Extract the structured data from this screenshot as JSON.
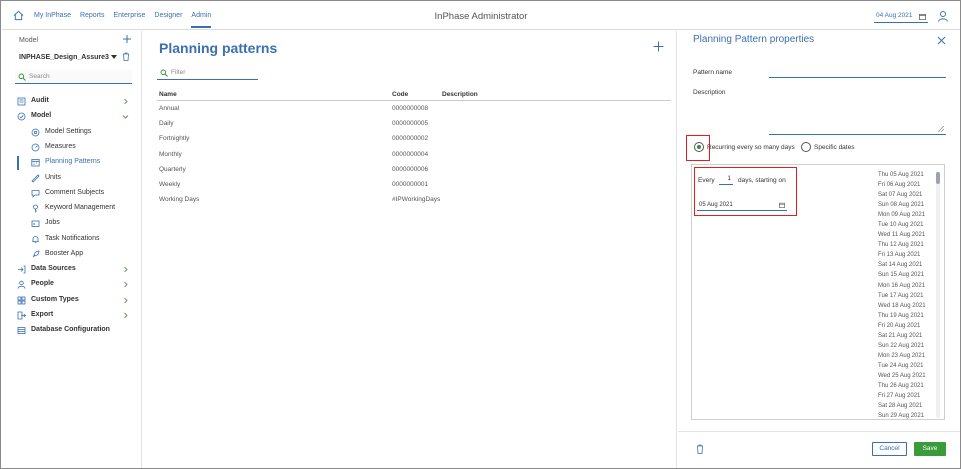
{
  "nav": {
    "links": [
      "My InPhase",
      "Reports",
      "Enterprise",
      "Designer",
      "Admin"
    ],
    "active": "Admin",
    "app_title": "InPhase Administrator",
    "date": "04 Aug 2021"
  },
  "sidebar": {
    "model_label": "Model",
    "model_name": "INPHASE_Design_Assure3",
    "search_placeholder": "Search",
    "items": [
      {
        "label": "Audit",
        "level": "top",
        "icon": "audit-icon",
        "chevron": "right"
      },
      {
        "label": "Model",
        "level": "top",
        "icon": "model-icon",
        "chevron": "down"
      },
      {
        "label": "Model Settings",
        "level": "sub",
        "icon": "settings-icon"
      },
      {
        "label": "Measures",
        "level": "sub",
        "icon": "gauge-icon"
      },
      {
        "label": "Planning Patterns",
        "level": "sub",
        "icon": "calendar-icon",
        "selected": true
      },
      {
        "label": "Units",
        "level": "sub",
        "icon": "ruler-icon"
      },
      {
        "label": "Comment Subjects",
        "level": "sub",
        "icon": "comment-icon"
      },
      {
        "label": "Keyword Management",
        "level": "sub",
        "icon": "key-icon"
      },
      {
        "label": "Jobs",
        "level": "sub",
        "icon": "jobs-icon"
      },
      {
        "label": "Task Notifications",
        "level": "sub",
        "icon": "bell-icon"
      },
      {
        "label": "Booster App",
        "level": "sub",
        "icon": "rocket-icon"
      },
      {
        "label": "Data Sources",
        "level": "top",
        "icon": "data-source-icon",
        "chevron": "right"
      },
      {
        "label": "People",
        "level": "top",
        "icon": "people-icon",
        "chevron": "right"
      },
      {
        "label": "Custom Types",
        "level": "top",
        "icon": "custom-types-icon",
        "chevron": "right"
      },
      {
        "label": "Export",
        "level": "top",
        "icon": "export-icon",
        "chevron": "right"
      },
      {
        "label": "Database Configuration",
        "level": "top",
        "icon": "database-icon"
      }
    ]
  },
  "main": {
    "title": "Planning patterns",
    "filter_placeholder": "Filter",
    "columns": [
      "Name",
      "Code",
      "Description"
    ],
    "rows": [
      {
        "name": "Annual",
        "code": "0000000008",
        "description": ""
      },
      {
        "name": "Daily",
        "code": "0000000005",
        "description": ""
      },
      {
        "name": "Fortnightly",
        "code": "0000000002",
        "description": ""
      },
      {
        "name": "Monthly",
        "code": "0000000004",
        "description": ""
      },
      {
        "name": "Quarterly",
        "code": "0000000006",
        "description": ""
      },
      {
        "name": "Weekly",
        "code": "0000000001",
        "description": ""
      },
      {
        "name": "Working Days",
        "code": "#IPWorkingDays",
        "description": ""
      }
    ]
  },
  "panel": {
    "title": "Planning Pattern properties",
    "pattern_name_label": "Pattern name",
    "pattern_name_value": "",
    "description_label": "Description",
    "description_value": "",
    "radio_recurring": "Recurring every so many days",
    "radio_specific": "Specific dates",
    "selected_mode": "recurring",
    "every_label": "Every",
    "every_value": "1",
    "days_label": "days, starting on",
    "start_date": "05 Aug 2021",
    "dates": [
      "Thu 05 Aug 2021",
      "Fri 06 Aug 2021",
      "Sat 07 Aug 2021",
      "Sun 08 Aug 2021",
      "Mon 09 Aug 2021",
      "Tue 10 Aug 2021",
      "Wed 11 Aug 2021",
      "Thu 12 Aug 2021",
      "Fri 13 Aug 2021",
      "Sat 14 Aug 2021",
      "Sun 15 Aug 2021",
      "Mon 16 Aug 2021",
      "Tue 17 Aug 2021",
      "Wed 18 Aug 2021",
      "Thu 19 Aug 2021",
      "Fri 20 Aug 2021",
      "Sat 21 Aug 2021",
      "Sun 22 Aug 2021",
      "Mon 23 Aug 2021",
      "Tue 24 Aug 2021",
      "Wed 25 Aug 2021",
      "Thu 26 Aug 2021",
      "Fri 27 Aug 2021",
      "Sat 28 Aug 2021",
      "Sun 29 Aug 2021"
    ],
    "cancel_label": "Cancel",
    "save_label": "Save"
  },
  "colors": {
    "accent": "#3a6fb0",
    "save": "#3a9b3a",
    "highlight": "#e02020"
  }
}
